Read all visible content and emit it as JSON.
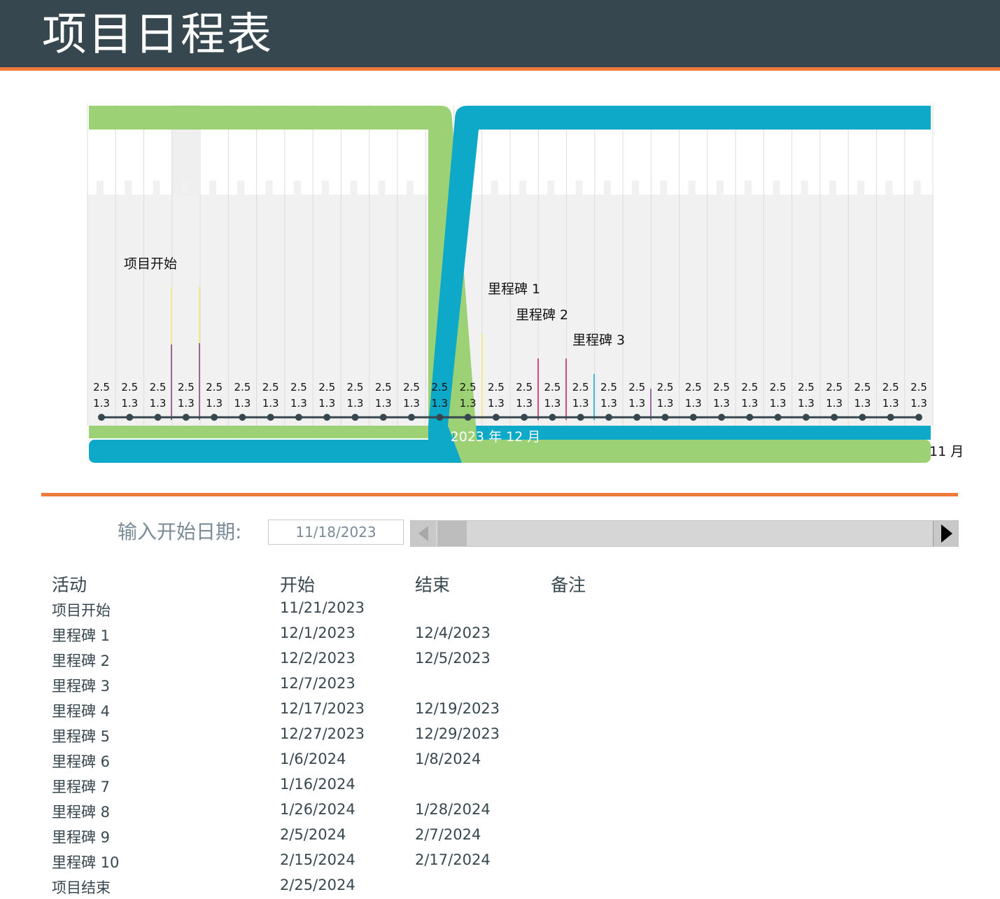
{
  "header": {
    "title": "项目日程表"
  },
  "colors": {
    "header_bg": "#37474f",
    "accent": "#f07a3a",
    "green": "#9cd175",
    "blue": "#0ea8c8",
    "grid_bg": "#f1f1f1"
  },
  "chart_data": {
    "type": "timeline",
    "timeline_label": "2023 年 12 月",
    "end_label": "11 月",
    "tick_top_label": "2.5",
    "tick_bottom_label": "1.3",
    "tick_count": 30,
    "callouts": [
      {
        "text": "项目开始"
      },
      {
        "text": "里程碑  1"
      },
      {
        "text": "里程碑  2"
      },
      {
        "text": "里程碑  3"
      }
    ]
  },
  "controls": {
    "start_date_label": "输入开始日期:",
    "start_date_value": "11/18/2023"
  },
  "table": {
    "headers": [
      "活动",
      "开始",
      "结束",
      "备注"
    ],
    "rows": [
      {
        "activity": "项目开始",
        "start": "11/21/2023",
        "end": ""
      },
      {
        "activity": "里程碑 1",
        "start": "12/1/2023",
        "end": "12/4/2023"
      },
      {
        "activity": "里程碑 2",
        "start": "12/2/2023",
        "end": "12/5/2023"
      },
      {
        "activity": "里程碑 3",
        "start": "12/7/2023",
        "end": ""
      },
      {
        "activity": "里程碑 4",
        "start": "12/17/2023",
        "end": "12/19/2023"
      },
      {
        "activity": "里程碑 5",
        "start": "12/27/2023",
        "end": "12/29/2023"
      },
      {
        "activity": "里程碑 6",
        "start": "1/6/2024",
        "end": "1/8/2024"
      },
      {
        "activity": "里程碑 7",
        "start": "1/16/2024",
        "end": ""
      },
      {
        "activity": "里程碑 8",
        "start": "1/26/2024",
        "end": "1/28/2024"
      },
      {
        "activity": "里程碑 9",
        "start": "2/5/2024",
        "end": "2/7/2024"
      },
      {
        "activity": "里程碑 10",
        "start": "2/15/2024",
        "end": "2/17/2024"
      },
      {
        "activity": "项目结束",
        "start": "2/25/2024",
        "end": ""
      }
    ]
  }
}
